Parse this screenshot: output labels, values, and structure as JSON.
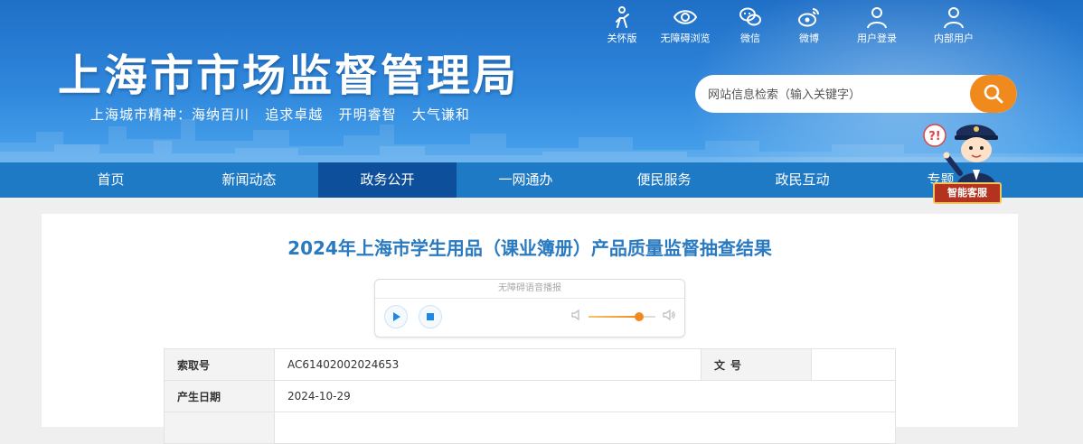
{
  "header": {
    "site_title": "上海市市场监督管理局",
    "motto": "上海城市精神：海纳百川   追求卓越   开明睿智   大气谦和",
    "tools": [
      {
        "label": "关怀版",
        "icon": "elderly-care-icon"
      },
      {
        "label": "无障碍浏览",
        "icon": "eye-icon"
      },
      {
        "label": "微信",
        "icon": "wechat-icon"
      },
      {
        "label": "微博",
        "icon": "weibo-icon"
      },
      {
        "label": "用户登录",
        "icon": "user-icon"
      },
      {
        "label": "内部用户",
        "icon": "user-icon"
      }
    ],
    "search": {
      "placeholder": "网站信息检索（输入关键字）",
      "icon": "search-icon"
    },
    "colors": {
      "header_blue": "#2f87dc",
      "nav_blue": "#1f7ac6",
      "nav_active": "#0d4f9a",
      "search_orange": "#f08a1c"
    }
  },
  "nav": {
    "items": [
      "首页",
      "新闻动态",
      "政务公开",
      "一网通办",
      "便民服务",
      "政民互动",
      "专题"
    ],
    "active": "政务公开"
  },
  "assistant": {
    "label": "智能客服"
  },
  "article": {
    "title": "2024年上海市学生用品（课业簿册）产品质量监督抽查结果",
    "title_color": "#2a7ac1",
    "player": {
      "title": "无障碍语音播报",
      "volume": 0.75
    },
    "meta": {
      "index_label": "索取号",
      "index_value": "AC61402002024653",
      "doc_no_label": "文号",
      "doc_no_value": "",
      "date_label": "产生日期",
      "date_value": "2024-10-29"
    }
  }
}
